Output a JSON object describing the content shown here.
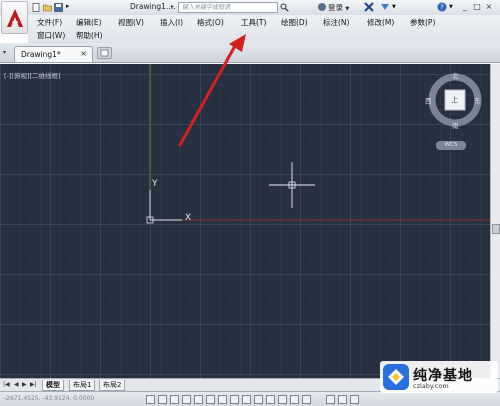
{
  "window": {
    "doc_title": "Drawing1....",
    "search_placeholder": "键入关键字或短语",
    "login_label": "登录",
    "help_label": "?",
    "controls": [
      "_",
      "□",
      "×"
    ]
  },
  "menu": {
    "items": [
      {
        "label": "文件(F)"
      },
      {
        "label": "编辑(E)"
      },
      {
        "label": "视图(V)"
      },
      {
        "label": "插入(I)"
      },
      {
        "label": "格式(O)"
      },
      {
        "label": "工具(T)"
      },
      {
        "label": "绘图(D)"
      },
      {
        "label": "标注(N)"
      },
      {
        "label": "修改(M)"
      },
      {
        "label": "参数(P)"
      },
      {
        "label": "窗口(W)"
      },
      {
        "label": "帮助(H)"
      }
    ]
  },
  "tabs": {
    "document": "Drawing1*",
    "close": "×"
  },
  "canvas": {
    "viewport_label": "[-][俯视][二维线框]",
    "ucs_y": "Y",
    "ucs_x": "X",
    "compass": {
      "north": "北",
      "south": "南",
      "east": "东",
      "west": "西",
      "face": "上"
    },
    "wcs": "WCS"
  },
  "layout_tabs": [
    {
      "label": "模型",
      "active": true
    },
    {
      "label": "布局1",
      "active": false
    },
    {
      "label": "布局2",
      "active": false
    }
  ],
  "status": {
    "coords": "-2671.4525, -43.9124, 0.0000"
  },
  "watermark": {
    "title": "纯净基地",
    "url": "czlaby.com"
  },
  "colors": {
    "canvas_bg": "#263040",
    "annotation_arrow": "#d42020",
    "ucs_y_axis": "#3a9a3a",
    "ucs_x_axis": "#b03030"
  }
}
